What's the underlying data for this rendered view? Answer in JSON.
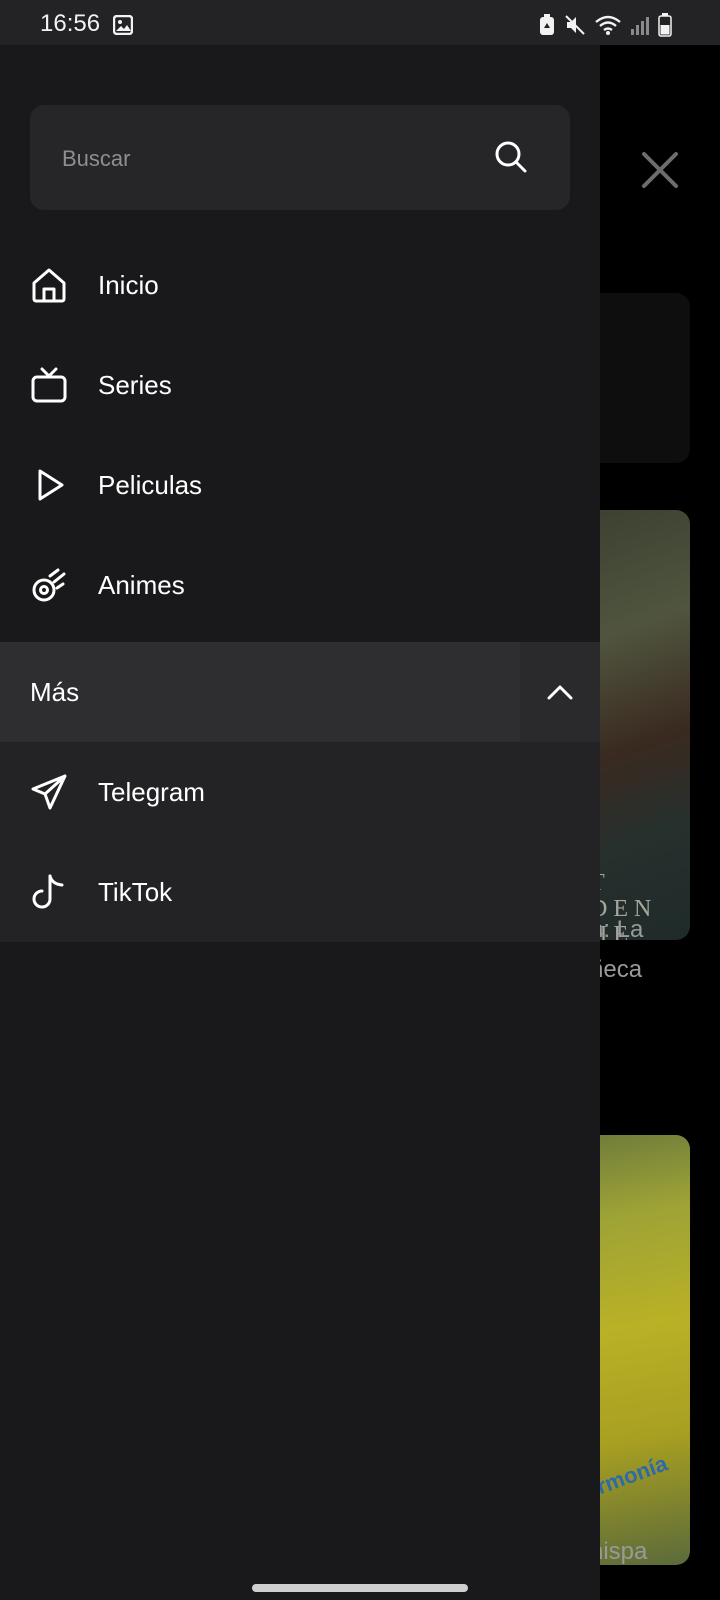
{
  "status_bar": {
    "time": "16:56",
    "icons": [
      "image-icon",
      "battery-saver-icon",
      "mute-icon",
      "wifi-icon",
      "signal-icon",
      "battery-icon"
    ]
  },
  "drawer": {
    "search": {
      "placeholder": "Buscar",
      "value": ""
    },
    "nav_items": [
      {
        "label": "Inicio",
        "icon": "home-icon"
      },
      {
        "label": "Series",
        "icon": "tv-icon"
      },
      {
        "label": "Peliculas",
        "icon": "play-icon"
      },
      {
        "label": "Animes",
        "icon": "anime-icon"
      }
    ],
    "more": {
      "label": "Más",
      "expanded": true,
      "items": [
        {
          "label": "Telegram",
          "icon": "telegram-icon"
        },
        {
          "label": "TikTok",
          "icon": "tiktok-icon"
        }
      ]
    }
  },
  "background": {
    "poster_1_text": "T\nDEN\nHE\nDOLL",
    "title_1_line1": "n: La",
    "title_1_line2": "ñeca",
    "poster_2_text": "Armonía",
    "title_2_line1": "hispa"
  },
  "colors": {
    "drawer_bg": "#19191b",
    "search_bg": "#262628",
    "more_header_bg": "#2e2e31",
    "more_panel_bg": "#232325"
  }
}
